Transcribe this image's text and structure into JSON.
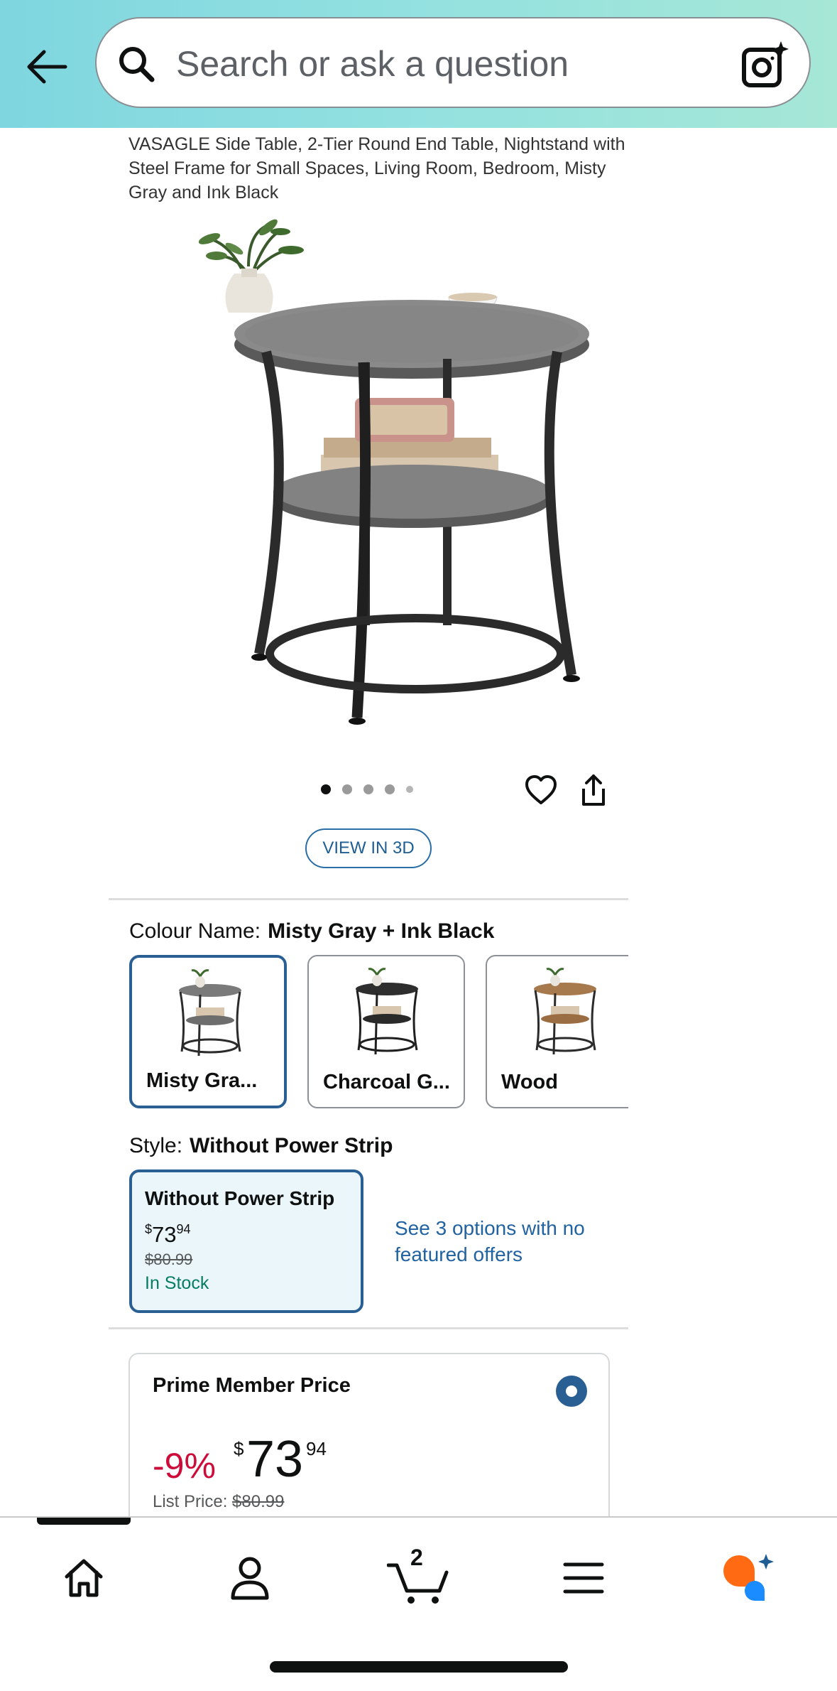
{
  "search": {
    "placeholder": "Search or ask a question"
  },
  "product": {
    "title": "VASAGLE Side Table, 2-Tier Round End Table, Nightstand with Steel Frame for Small Spaces, Living Room, Bedroom, Misty Gray and Ink Black"
  },
  "gallery": {
    "dot_count": 5,
    "active_dot": 0
  },
  "view3d_label": "VIEW IN 3D",
  "colour": {
    "label": "Colour Name:",
    "selected": "Misty Gray + Ink Black",
    "options": [
      {
        "name": "Misty Gra...",
        "top": "#7a7a7a",
        "shelf": "#6d6d6d",
        "selected": true
      },
      {
        "name": "Charcoal G...",
        "top": "#2e2e2e",
        "shelf": "#2a2a2a",
        "selected": false
      },
      {
        "name": "Wood",
        "top": "#a77a4e",
        "shelf": "#9a6d42",
        "selected": false
      }
    ]
  },
  "style": {
    "label": "Style:",
    "selected": "Without Power Strip",
    "card": {
      "name": "Without Power Strip",
      "currency": "$",
      "price_whole": "73",
      "price_fraction": "94",
      "was": "$80.99",
      "stock": "In Stock"
    },
    "see_options": "See 3 options with no featured offers"
  },
  "prime": {
    "label": "Prime Member Price",
    "discount": "-9%",
    "currency": "$",
    "price_whole": "73",
    "price_fraction": "94",
    "list_label": "List Price:",
    "list_price": "$80.99"
  },
  "nav": {
    "cart_count": "2"
  },
  "colors": {
    "accent_blue": "#2a5f94",
    "link_blue": "#2162a1",
    "discount_red": "#cc0c39",
    "stock_green": "#067d62",
    "assistant_orange": "#ff6a13",
    "assistant_blue": "#1a8cff"
  }
}
